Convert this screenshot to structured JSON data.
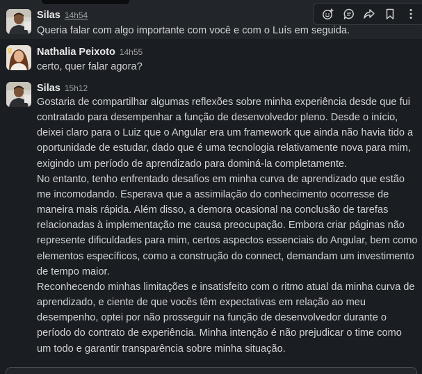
{
  "messages": [
    {
      "author": "Silas",
      "time": "14h54",
      "lines": [
        "Queria falar com algo importante com você e com o Luís em seguida."
      ]
    },
    {
      "author": "Nathalia Peixoto",
      "time": "14h55",
      "lines": [
        "certo, quer falar agora?"
      ]
    },
    {
      "author": "Silas",
      "time": "15h12",
      "lines": [
        "Gostaria de compartilhar algumas reflexões sobre minha experiência desde que fui",
        "contratado para desempenhar a função de desenvolvedor pleno. Desde o início,",
        "deixei claro para o Luiz que o Angular era um framework que ainda não havia tido a",
        "oportunidade de estudar, dado que é uma tecnologia relativamente nova para mim,",
        "exigindo um período de aprendizado para dominá-la completamente.",
        "No entanto, tenho enfrentado desafios em minha curva de aprendizado que estão",
        "me incomodando. Esperava que a assimilação do conhecimento ocorresse de",
        "maneira mais rápida. Além disso, a demora ocasional na conclusão de tarefas",
        "relacionadas à implementação me causa preocupação. Embora criar páginas não",
        "represente dificuldades para mim, certos aspectos essenciais do Angular, bem como",
        "elementos específicos, como a construção do connect, demandam um investimento",
        "de tempo maior.",
        "Reconhecendo minhas limitações e insatisfeito com o ritmo atual da minha curva de",
        "aprendizado, e ciente de que vocês têm expectativas em relação ao meu",
        "desempenho, optei por não prosseguir na função de desenvolvedor durante o",
        "período do contrato de experiência. Minha intenção é não prejudicar o time como",
        "um todo e garantir transparência sobre minha situação."
      ]
    }
  ],
  "toolbar": {
    "icons": [
      "add-reaction-icon",
      "reply-in-thread-icon",
      "forward-icon",
      "bookmark-icon",
      "more-actions-icon"
    ]
  },
  "colors": {
    "background": "#1a1d21",
    "hover_row": "#222529",
    "text": "#d1d2d3",
    "name": "#e8e8e8",
    "timestamp": "#a1a3a6"
  }
}
